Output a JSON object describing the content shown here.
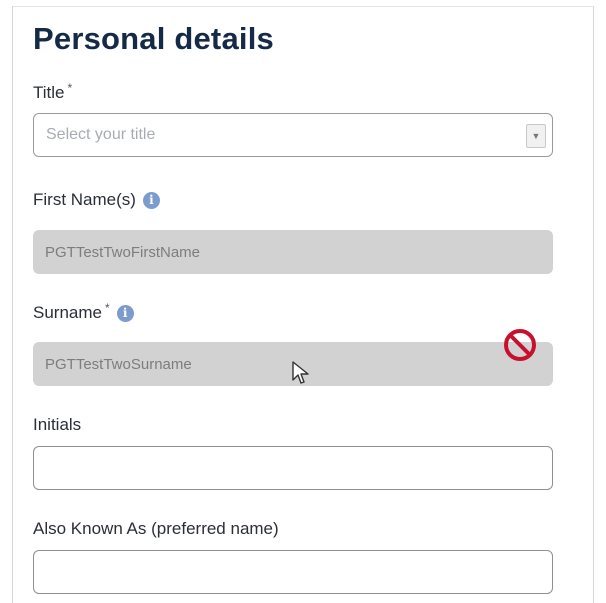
{
  "section": {
    "heading": "Personal details"
  },
  "fields": {
    "title": {
      "label": "Title",
      "required_mark": "*",
      "placeholder": "Select your title"
    },
    "first_names": {
      "label": "First Name(s)",
      "info": "i",
      "value": "PGTTestTwoFirstName"
    },
    "surname": {
      "label": "Surname",
      "required_mark": "*",
      "info": "i",
      "value": "PGTTestTwoSurname"
    },
    "initials": {
      "label": "Initials",
      "value": ""
    },
    "aka": {
      "label": "Also Known As (preferred name)",
      "value": ""
    }
  },
  "icons": {
    "info": "info-circle-icon",
    "select_arrow": "chevron-down-icon",
    "not_allowed": "not-allowed-cursor-icon",
    "pointer": "mouse-pointer-icon"
  },
  "colors": {
    "heading": "#152a47",
    "info_icon": "#7b9ccc",
    "disabled_bg": "#d2d2d2",
    "not_allowed": "#c8102e"
  }
}
